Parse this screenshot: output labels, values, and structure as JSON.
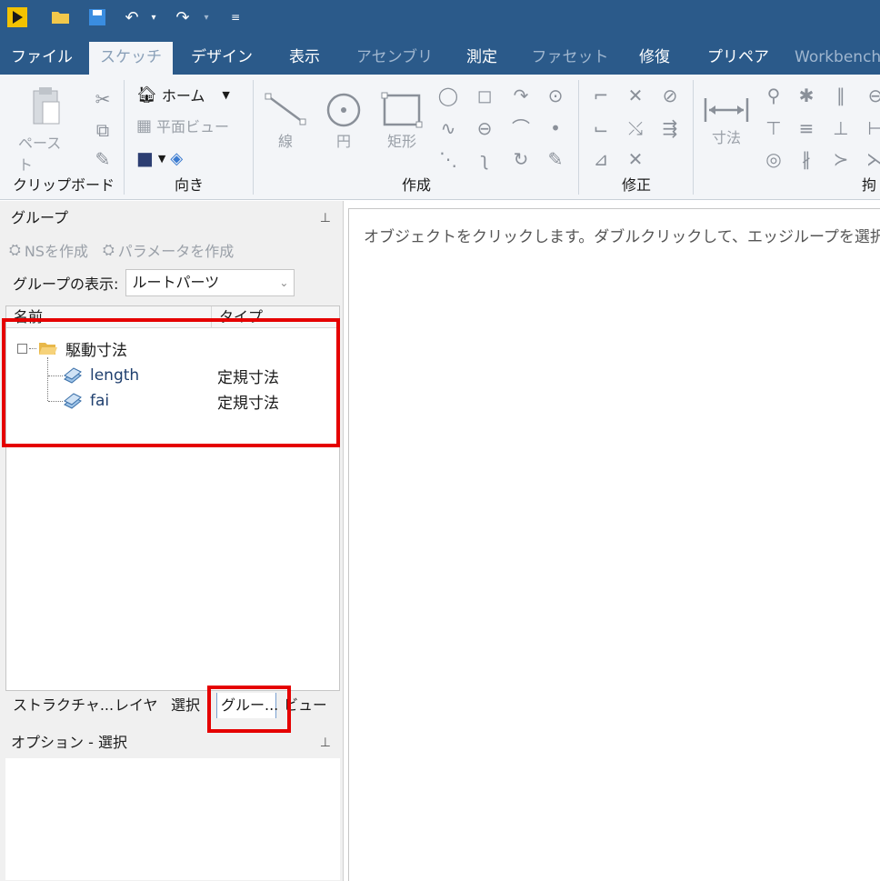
{
  "title_bar": {
    "quick_access": [
      "app-logo-icon",
      "open-folder-icon",
      "save-icon",
      "undo-icon",
      "redo-icon",
      "customize-icon"
    ]
  },
  "menu": {
    "tabs": [
      {
        "label": "ファイル",
        "state": "normal"
      },
      {
        "label": "スケッチ",
        "state": "active"
      },
      {
        "label": "デザイン",
        "state": "normal"
      },
      {
        "label": "表示",
        "state": "normal"
      },
      {
        "label": "アセンブリ",
        "state": "dim"
      },
      {
        "label": "測定",
        "state": "normal"
      },
      {
        "label": "ファセット",
        "state": "dim"
      },
      {
        "label": "修復",
        "state": "normal"
      },
      {
        "label": "プリペア",
        "state": "normal"
      },
      {
        "label": "Workbench",
        "state": "dim"
      }
    ]
  },
  "ribbon": {
    "clipboard": {
      "label": "クリップボード",
      "paste": "ペースト"
    },
    "orient": {
      "label": "向き",
      "home": "ホーム",
      "plan_view": "平面ビュー"
    },
    "create": {
      "label": "作成",
      "line": "線",
      "circle": "円",
      "rectangle": "矩形"
    },
    "modify": {
      "label": "修正"
    },
    "dimension": {
      "label": "寸法"
    },
    "constraint": {
      "label": "拘"
    }
  },
  "groups_panel": {
    "title": "グループ",
    "create_ns": "NSを作成",
    "create_param": "パラメータを作成",
    "display_label": "グループの表示:",
    "display_value": "ルートパーツ",
    "columns": {
      "name": "名前",
      "type": "タイプ"
    },
    "tree": {
      "folder": "駆動寸法",
      "items": [
        {
          "name": "length",
          "type": "定規寸法"
        },
        {
          "name": "fai",
          "type": "定規寸法"
        }
      ]
    }
  },
  "bottom_tabs": [
    "ストラクチャ...",
    "レイヤ",
    "選択",
    "グルー...",
    "ビュー"
  ],
  "options_panel": {
    "title": "オプション - 選択"
  },
  "main": {
    "hint": "オブジェクトをクリックします。ダブルクリックして、エッジループを選択"
  },
  "colors": {
    "titlebar": "#2b5a8a",
    "highlight": "#e50000",
    "ribbon_bg": "#f3f5f8"
  }
}
